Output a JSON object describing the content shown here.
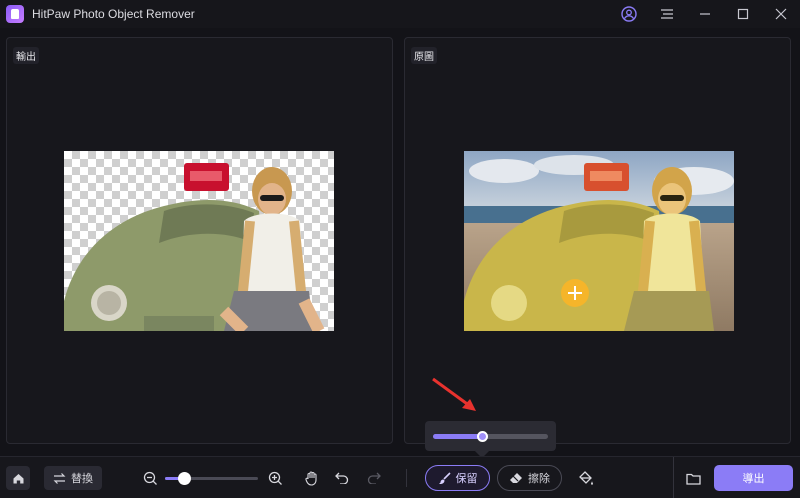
{
  "app": {
    "title": "HitPaw Photo Object Remover"
  },
  "window_controls": {
    "account_icon": "user-circle-icon",
    "menu_icon": "hamburger-icon",
    "minimize_icon": "minimize-icon",
    "maximize_icon": "maximize-icon",
    "close_icon": "close-icon"
  },
  "panels": {
    "output": {
      "label": "輸出"
    },
    "original": {
      "label": "原圖"
    }
  },
  "toolbar": {
    "replace_label": "替換",
    "keep_label": "保留",
    "erase_label": "擦除",
    "export_label": "導出",
    "zoom_level": 0.2
  },
  "brush_popup": {
    "brush_size": 0.43
  },
  "colors": {
    "accent": "#8b7cf6",
    "background": "#131318",
    "panel": "#17171c",
    "annotation_arrow": "#e8322e"
  }
}
